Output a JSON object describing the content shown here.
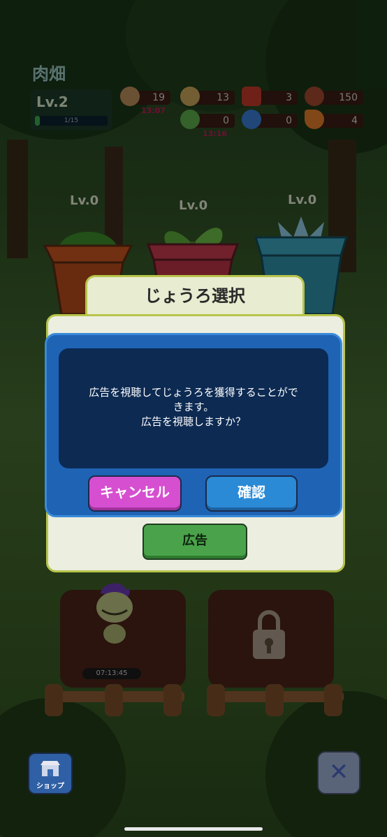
{
  "hud": {
    "area_title": "肉畑",
    "level": "Lv.2",
    "xp_text": "1/15",
    "xp_progress": 0.067,
    "resources": [
      {
        "icon": "money-bag-icon",
        "value": "19",
        "timer": "13:07"
      },
      {
        "icon": "seed-bag-icon",
        "value": "13",
        "timer": ""
      },
      {
        "icon": "red-fertilizer-icon",
        "value": "3",
        "timer": ""
      },
      {
        "icon": "meat-icon",
        "value": "150",
        "timer": ""
      },
      {
        "icon": "green-watering-can-icon",
        "value": "0",
        "timer": "13:16"
      },
      {
        "icon": "blue-watering-can-icon",
        "value": "0",
        "timer": ""
      },
      {
        "icon": "carrot-icon",
        "value": "4",
        "timer": ""
      }
    ]
  },
  "pots": [
    {
      "label": "Lv.0"
    },
    {
      "label": "Lv.0"
    },
    {
      "label": "Lv.0"
    }
  ],
  "plot": {
    "timer": "07:13:45"
  },
  "panel": {
    "title": "じょうろ選択",
    "ad_button": "広告"
  },
  "dialog": {
    "message_lines": [
      "広告を視聴してじょうろを獲得することがで",
      "きます。",
      "広告を視聴しますか？"
    ],
    "cancel_label": "キャンセル",
    "confirm_label": "確認"
  },
  "bottom": {
    "shop_label": "ショップ",
    "close_label": "✕"
  },
  "colors": {
    "dialog_blue": "#1f63b5",
    "cancel_pink": "#d64fd0",
    "confirm_blue": "#2a8ad6",
    "ad_green": "#4aa34a"
  }
}
